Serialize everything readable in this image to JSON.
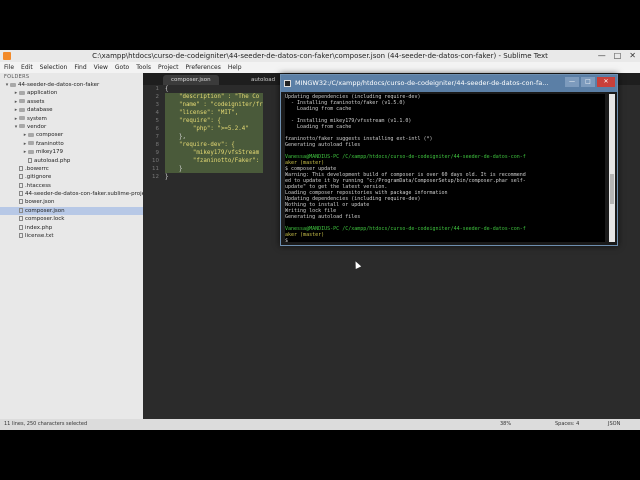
{
  "window": {
    "title": "C:\\xampp\\htdocs\\curso-de-codeigniter\\44-seeder-de-datos-con-faker\\composer.json (44-seeder-de-datos-con-faker) - Sublime Text",
    "min": "—",
    "max": "□",
    "close": "✕"
  },
  "menu": [
    "File",
    "Edit",
    "Selection",
    "Find",
    "View",
    "Goto",
    "Tools",
    "Project",
    "Preferences",
    "Help"
  ],
  "sidebar": {
    "header": "FOLDERS",
    "items": [
      {
        "label": "44-seeder-de-datos-con-faker",
        "type": "folder",
        "depth": 0,
        "open": true
      },
      {
        "label": "application",
        "type": "folder",
        "depth": 1,
        "open": false
      },
      {
        "label": "assets",
        "type": "folder",
        "depth": 1,
        "open": false
      },
      {
        "label": "database",
        "type": "folder",
        "depth": 1,
        "open": false
      },
      {
        "label": "system",
        "type": "folder",
        "depth": 1,
        "open": false
      },
      {
        "label": "vendor",
        "type": "folder",
        "depth": 1,
        "open": true
      },
      {
        "label": "composer",
        "type": "folder",
        "depth": 2,
        "open": false
      },
      {
        "label": "fzaninotto",
        "type": "folder",
        "depth": 2,
        "open": false
      },
      {
        "label": "mikey179",
        "type": "folder",
        "depth": 2,
        "open": false
      },
      {
        "label": "autoload.php",
        "type": "file",
        "depth": 2
      },
      {
        "label": ".bowerrc",
        "type": "file",
        "depth": 1
      },
      {
        "label": ".gitignore",
        "type": "file",
        "depth": 1
      },
      {
        "label": ".htaccess",
        "type": "file",
        "depth": 1
      },
      {
        "label": "44-seeder-de-datos-con-faker.sublime-proje",
        "type": "file",
        "depth": 1
      },
      {
        "label": "bower.json",
        "type": "file",
        "depth": 1
      },
      {
        "label": "composer.json",
        "type": "file",
        "depth": 1,
        "selected": true
      },
      {
        "label": "composer.lock",
        "type": "file",
        "depth": 1
      },
      {
        "label": "index.php",
        "type": "file",
        "depth": 1
      },
      {
        "label": "license.txt",
        "type": "file",
        "depth": 1
      }
    ]
  },
  "tabs": [
    {
      "label": "composer.json",
      "active": true
    },
    {
      "label": "autoload",
      "active": false
    }
  ],
  "editor": {
    "line_numbers": [
      "1",
      "2",
      "3",
      "4",
      "5",
      "6",
      "7",
      "8",
      "9",
      "10",
      "11",
      "12"
    ],
    "lines": [
      "{",
      "    \"description\" : \"The Co",
      "    \"name\" : \"codeigniter/fr",
      "    \"license\": \"MIT\",",
      "    \"require\": {",
      "        \"php\": \">=5.2.4\"",
      "    },",
      "    \"require-dev\": {",
      "        \"mikey179/vfsStream",
      "        \"fzaninotto/Faker\":",
      "    }",
      "}"
    ]
  },
  "terminal": {
    "title": "MINGW32:/C/xampp/htdocs/curso-de-codeigniter/44-seeder-de-datos-con-fa...",
    "lines": [
      {
        "t": "Updating dependencies (including require-dev)",
        "c": ""
      },
      {
        "t": "  - Installing fzaninotto/faker (v1.5.0)",
        "c": ""
      },
      {
        "t": "    Loading from cache",
        "c": ""
      },
      {
        "t": "",
        "c": ""
      },
      {
        "t": "  - Installing mikey179/vfsstream (v1.1.0)",
        "c": ""
      },
      {
        "t": "    Loading from cache",
        "c": ""
      },
      {
        "t": "",
        "c": ""
      },
      {
        "t": "fzaninotto/faker suggests installing ext-intl (*)",
        "c": ""
      },
      {
        "t": "Generating autoload files",
        "c": ""
      },
      {
        "t": "",
        "c": ""
      },
      {
        "t": "Vanessa@MANDIUS-PC /C/xampp/htdocs/curso-de-codeigniter/44-seeder-de-datos-con-f",
        "c": "g"
      },
      {
        "t": "aker (master)",
        "c": "y"
      },
      {
        "t": "$ composer update",
        "c": ""
      },
      {
        "t": "Warning: This development build of composer is over 60 days old. It is recommend",
        "c": ""
      },
      {
        "t": "ed to update it by running \"c:/ProgramData/ComposerSetup/bin/composer.phar self-",
        "c": ""
      },
      {
        "t": "update\" to get the latest version.",
        "c": ""
      },
      {
        "t": "Loading composer repositories with package information",
        "c": ""
      },
      {
        "t": "Updating dependencies (including require-dev)",
        "c": ""
      },
      {
        "t": "Nothing to install or update",
        "c": ""
      },
      {
        "t": "Writing lock file",
        "c": ""
      },
      {
        "t": "Generating autoload files",
        "c": ""
      },
      {
        "t": "",
        "c": ""
      },
      {
        "t": "Vanessa@MANDIUS-PC /C/xampp/htdocs/curso-de-codeigniter/44-seeder-de-datos-con-f",
        "c": "g"
      },
      {
        "t": "aker (master)",
        "c": "y"
      },
      {
        "t": "$",
        "c": ""
      }
    ]
  },
  "statusbar": {
    "left": "11 lines, 250 characters selected",
    "zoom": "38%",
    "spaces": "Spaces: 4",
    "syntax": "JSON"
  }
}
